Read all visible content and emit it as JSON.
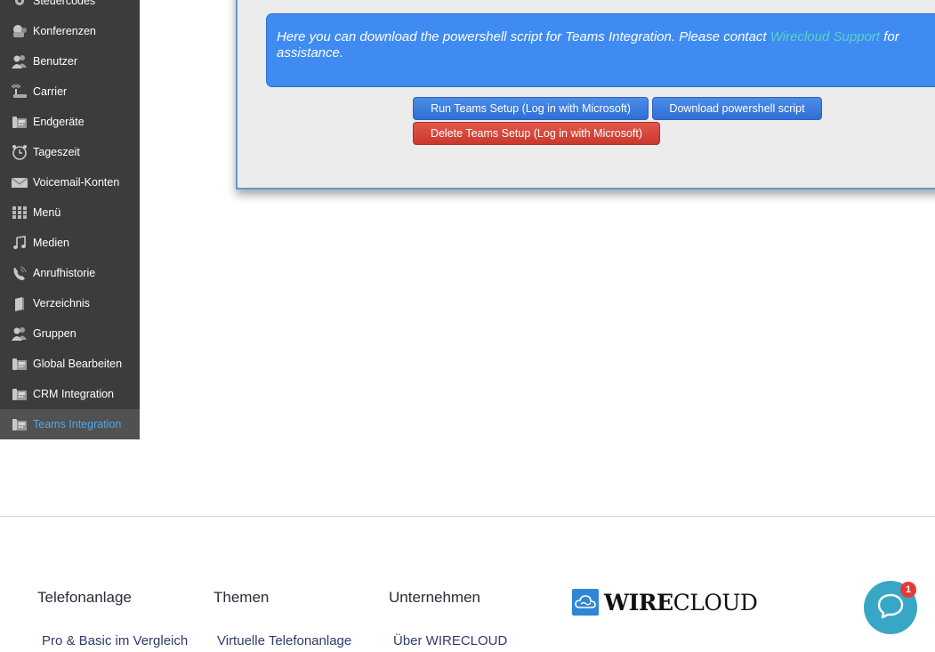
{
  "sidebar": {
    "items": [
      {
        "label": "Steuercodes",
        "icon": "gear-icon"
      },
      {
        "label": "Konferenzen",
        "icon": "conference-icon"
      },
      {
        "label": "Benutzer",
        "icon": "users-icon"
      },
      {
        "label": "Carrier",
        "icon": "antenna-icon"
      },
      {
        "label": "Endgeräte",
        "icon": "phone-icon"
      },
      {
        "label": "Tageszeit",
        "icon": "clock-icon"
      },
      {
        "label": "Voicemail-Konten",
        "icon": "mail-icon"
      },
      {
        "label": "Menü",
        "icon": "grid-icon"
      },
      {
        "label": "Medien",
        "icon": "music-icon"
      },
      {
        "label": "Anrufhistorie",
        "icon": "handset-icon"
      },
      {
        "label": "Verzeichnis",
        "icon": "book-icon"
      },
      {
        "label": "Gruppen",
        "icon": "users-icon"
      },
      {
        "label": "Global Bearbeiten",
        "icon": "phone-icon"
      },
      {
        "label": "CRM Integration",
        "icon": "phone-icon"
      },
      {
        "label": "Teams Integration",
        "icon": "phone-icon"
      }
    ],
    "active_label": "Teams Integration",
    "active_color": "#4ea8e6"
  },
  "panel": {
    "info_text_before": "Here you can download the powershell script for Teams Integration. Please contact ",
    "info_link": "Wirecloud Support",
    "info_text_after": " for assistance.",
    "run_setup_label": "Run Teams Setup (Log in with Microsoft)",
    "download_label": "Download powershell script",
    "delete_setup_label": "Delete Teams Setup (Log in with Microsoft)"
  },
  "footer": {
    "col1_heading": "Telefonanlage",
    "col1_link": "Pro & Basic im Vergleich",
    "col2_heading": "Themen",
    "col2_link": "Virtuelle Telefonanlage",
    "col3_heading": "Unternehmen",
    "col3_link": "Über WIRECLOUD",
    "logo_bold": "WIRE",
    "logo_rest": "CLOUD",
    "chat_badge": "1"
  },
  "colors": {
    "sidebar_bg": "#3c3c3c",
    "info_box": "#3f8bf2",
    "button_blue": "#2f6fd6",
    "button_red": "#c9382d",
    "chat": "#38a7c6"
  }
}
